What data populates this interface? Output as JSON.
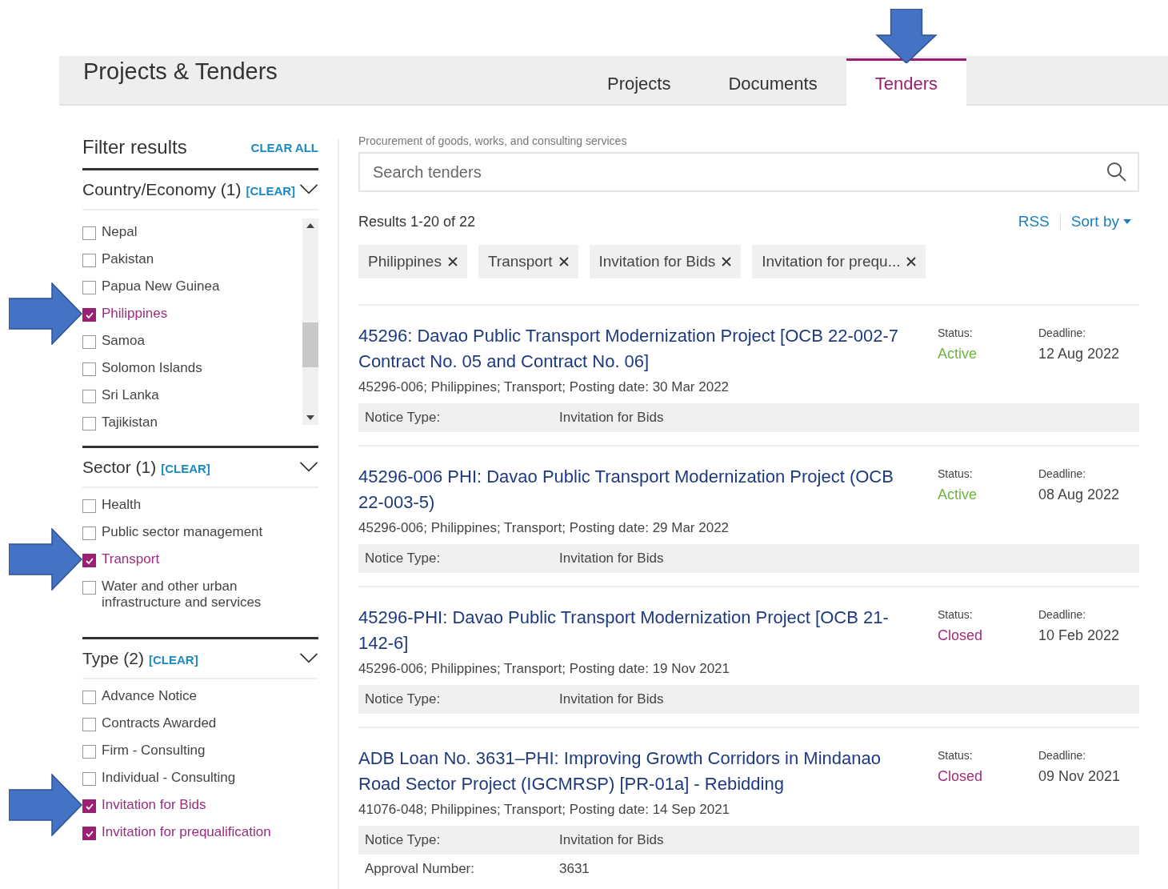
{
  "page": {
    "title": "Projects & Tenders"
  },
  "tabs": [
    {
      "label": "Projects",
      "selected": false,
      "annotated": false
    },
    {
      "label": "Documents",
      "selected": false,
      "annotated": false
    },
    {
      "label": "Tenders",
      "selected": true,
      "annotated": true
    }
  ],
  "filters": {
    "title": "Filter results",
    "clear_all": "CLEAR ALL",
    "groups": [
      {
        "label": "Country/Economy (1)",
        "clear": "[CLEAR]",
        "scrollable": true,
        "items": [
          {
            "label": "Nepal",
            "checked": false,
            "annotated": false
          },
          {
            "label": "Pakistan",
            "checked": false,
            "annotated": false
          },
          {
            "label": "Papua New Guinea",
            "checked": false,
            "annotated": false
          },
          {
            "label": "Philippines",
            "checked": true,
            "annotated": true
          },
          {
            "label": "Samoa",
            "checked": false,
            "annotated": false
          },
          {
            "label": "Solomon Islands",
            "checked": false,
            "annotated": false
          },
          {
            "label": "Sri Lanka",
            "checked": false,
            "annotated": false
          },
          {
            "label": "Tajikistan",
            "checked": false,
            "annotated": false
          }
        ]
      },
      {
        "label": "Sector (1)",
        "clear": "[CLEAR]",
        "scrollable": false,
        "items": [
          {
            "label": "Health",
            "checked": false,
            "annotated": false
          },
          {
            "label": "Public sector management",
            "checked": false,
            "annotated": false
          },
          {
            "label": "Transport",
            "checked": true,
            "annotated": true
          },
          {
            "label": "Water and other urban infrastructure and services",
            "checked": false,
            "annotated": false
          }
        ]
      },
      {
        "label": "Type (2)",
        "clear": "[CLEAR]",
        "scrollable": false,
        "items": [
          {
            "label": "Advance Notice",
            "checked": false,
            "annotated": false
          },
          {
            "label": "Contracts Awarded",
            "checked": false,
            "annotated": false
          },
          {
            "label": "Firm - Consulting",
            "checked": false,
            "annotated": false
          },
          {
            "label": "Individual - Consulting",
            "checked": false,
            "annotated": false
          },
          {
            "label": "Invitation for Bids",
            "checked": true,
            "annotated": true
          },
          {
            "label": "Invitation for prequalification",
            "checked": true,
            "annotated": false
          }
        ]
      }
    ]
  },
  "search": {
    "caption": "Procurement of goods, works, and consulting services",
    "placeholder": "Search tenders"
  },
  "results": {
    "count": "Results 1-20 of 22",
    "rss": "RSS",
    "sort": "Sort by",
    "chips": [
      "Philippines",
      "Transport",
      "Invitation for Bids",
      "Invitation for prequ..."
    ],
    "items": [
      {
        "title": "45296: Davao Public Transport Modernization Project [OCB 22-002-7 Contract No. 05 and Contract No. 06]",
        "meta": "45296-006; Philippines; Transport; Posting date: 30 Mar 2022",
        "status_label": "Status:",
        "status": "Active",
        "color": "#6db33f",
        "deadline_label": "Deadline:",
        "deadline": "12 Aug 2022",
        "details": [
          {
            "label": "Notice Type:",
            "value": "Invitation for Bids"
          }
        ]
      },
      {
        "title": "45296-006 PHI: Davao Public Transport Modernization Project (OCB 22-003-5)",
        "meta": "45296-006; Philippines; Transport; Posting date: 29 Mar 2022",
        "status_label": "Status:",
        "status": "Active",
        "color": "#6db33f",
        "deadline_label": "Deadline:",
        "deadline": "08 Aug 2022",
        "details": [
          {
            "label": "Notice Type:",
            "value": "Invitation for Bids"
          }
        ]
      },
      {
        "title": "45296-PHI: Davao Public Transport Modernization Project [OCB 21-142-6]",
        "meta": "45296-006; Philippines; Transport; Posting date: 19 Nov 2021",
        "status_label": "Status:",
        "status": "Closed",
        "color": "#a0307a",
        "deadline_label": "Deadline:",
        "deadline": "10 Feb 2022",
        "details": [
          {
            "label": "Notice Type:",
            "value": "Invitation for Bids"
          }
        ]
      },
      {
        "title": "ADB Loan No. 3631–PHI: Improving Growth Corridors in Mindanao Road Sector Project (IGCMRSP) [PR-01a] - Rebidding",
        "meta": "41076-048; Philippines; Transport; Posting date: 14 Sep 2021",
        "status_label": "Status:",
        "status": "Closed",
        "color": "#a0307a",
        "deadline_label": "Deadline:",
        "deadline": "09 Nov 2021",
        "details": [
          {
            "label": "Notice Type:",
            "value": "Invitation for Bids"
          },
          {
            "label": "Approval Number:",
            "value": "3631"
          }
        ]
      }
    ]
  }
}
